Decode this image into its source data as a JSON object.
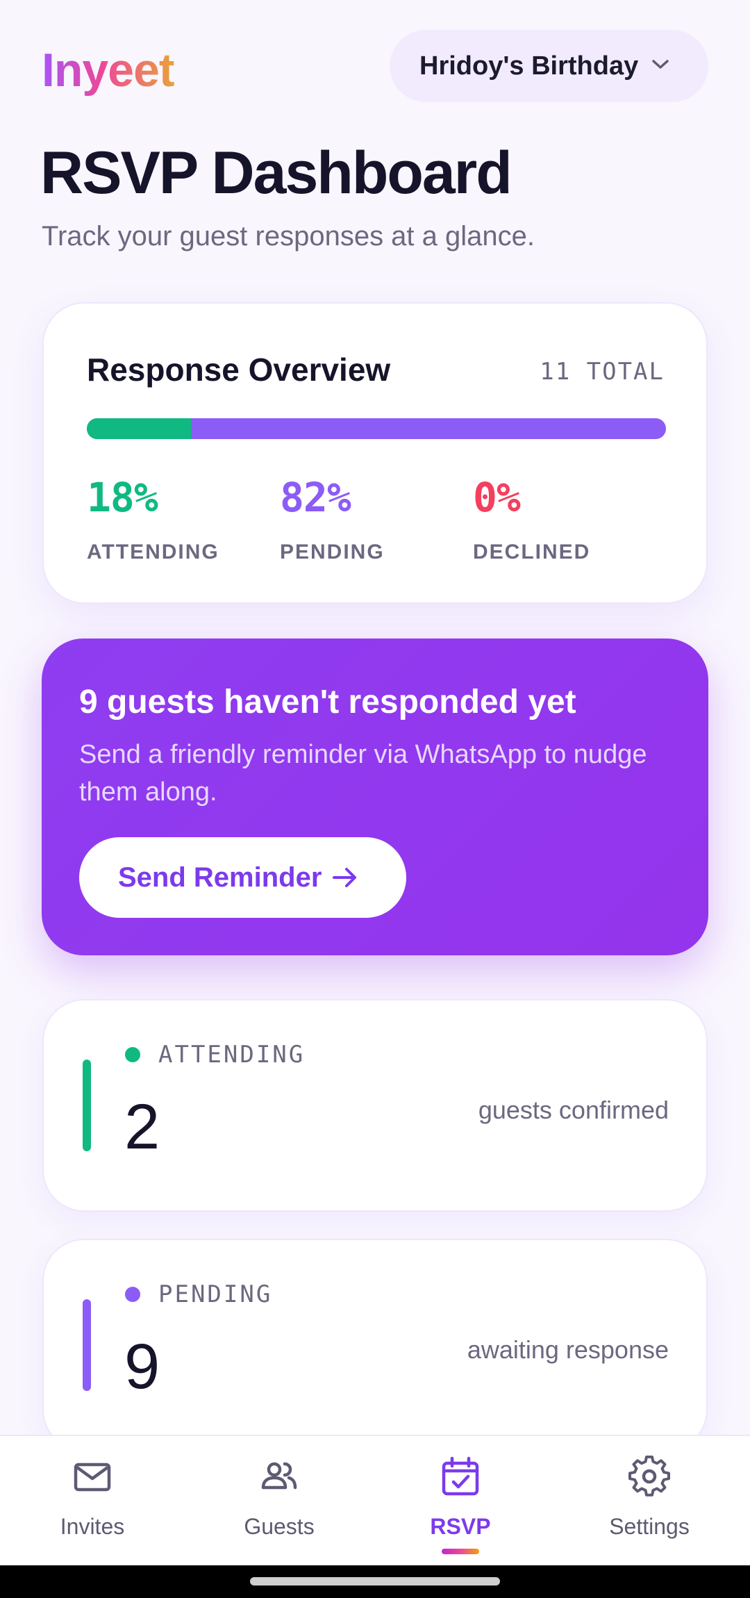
{
  "app": {
    "logo": "Inyeet",
    "event_selector": {
      "value": "Hridoy's Birthday"
    }
  },
  "header": {
    "title": "RSVP Dashboard",
    "subtitle": "Track your guest responses at a glance."
  },
  "overview": {
    "title": "Response Overview",
    "total_label": "11 TOTAL",
    "attending_fraction": 0.18,
    "stats": {
      "attending": {
        "pct": "18%",
        "label": "ATTENDING"
      },
      "pending": {
        "pct": "82%",
        "label": "PENDING"
      },
      "declined": {
        "pct": "0%",
        "label": "DECLINED"
      }
    }
  },
  "reminder": {
    "title": "9 guests haven't responded yet",
    "text": "Send a friendly reminder via WhatsApp to nudge them along.",
    "button_label": "Send Reminder"
  },
  "status_cards": {
    "attending": {
      "label": "ATTENDING",
      "count": "2",
      "description": "guests confirmed"
    },
    "pending": {
      "label": "PENDING",
      "count": "9",
      "description": "awaiting response"
    }
  },
  "nav": {
    "items": [
      {
        "label": "Invites",
        "icon": "mail-icon"
      },
      {
        "label": "Guests",
        "icon": "users-icon"
      },
      {
        "label": "RSVP",
        "icon": "calendar-check-icon",
        "active": true
      },
      {
        "label": "Settings",
        "icon": "gear-icon"
      }
    ]
  },
  "colors": {
    "attending": "#10b981",
    "pending": "#8b5cf6",
    "declined": "#f43f5e",
    "accent": "#7c3aed"
  }
}
